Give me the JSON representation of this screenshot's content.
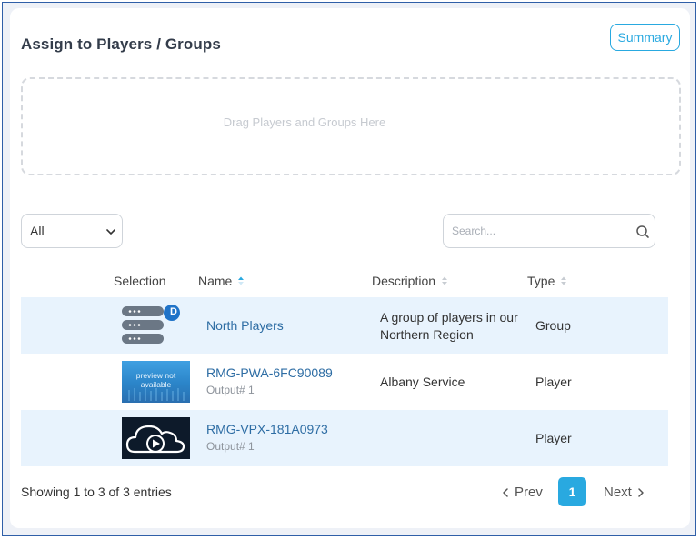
{
  "header": {
    "title": "Assign to Players / Groups",
    "summary_label": "Summary"
  },
  "dropzone": {
    "text": "Drag Players and Groups Here"
  },
  "filter": {
    "selected": "All"
  },
  "search": {
    "placeholder": "Search..."
  },
  "table": {
    "columns": [
      "Selection",
      "Name",
      "Description",
      "Type"
    ],
    "rows": [
      {
        "badge": "D",
        "name": "North Players",
        "output": "",
        "description": "A group of players in our Northern Region",
        "type": "Group",
        "thumb": "group-icon"
      },
      {
        "name": "RMG-PWA-6FC90089",
        "output": "Output# 1",
        "description": "Albany Service",
        "type": "Player",
        "thumb": "preview-not-available",
        "thumb_text": "preview not available"
      },
      {
        "name": "RMG-VPX-181A0973",
        "output": "Output# 1",
        "description": "",
        "type": "Player",
        "thumb": "cloud-play-icon"
      }
    ]
  },
  "footer": {
    "info": "Showing 1 to 3 of 3 entries",
    "prev": "Prev",
    "page": "1",
    "next": "Next"
  },
  "colors": {
    "accent": "#29a9e0",
    "row_highlight": "#e8f3fd",
    "link": "#2e6da4"
  }
}
